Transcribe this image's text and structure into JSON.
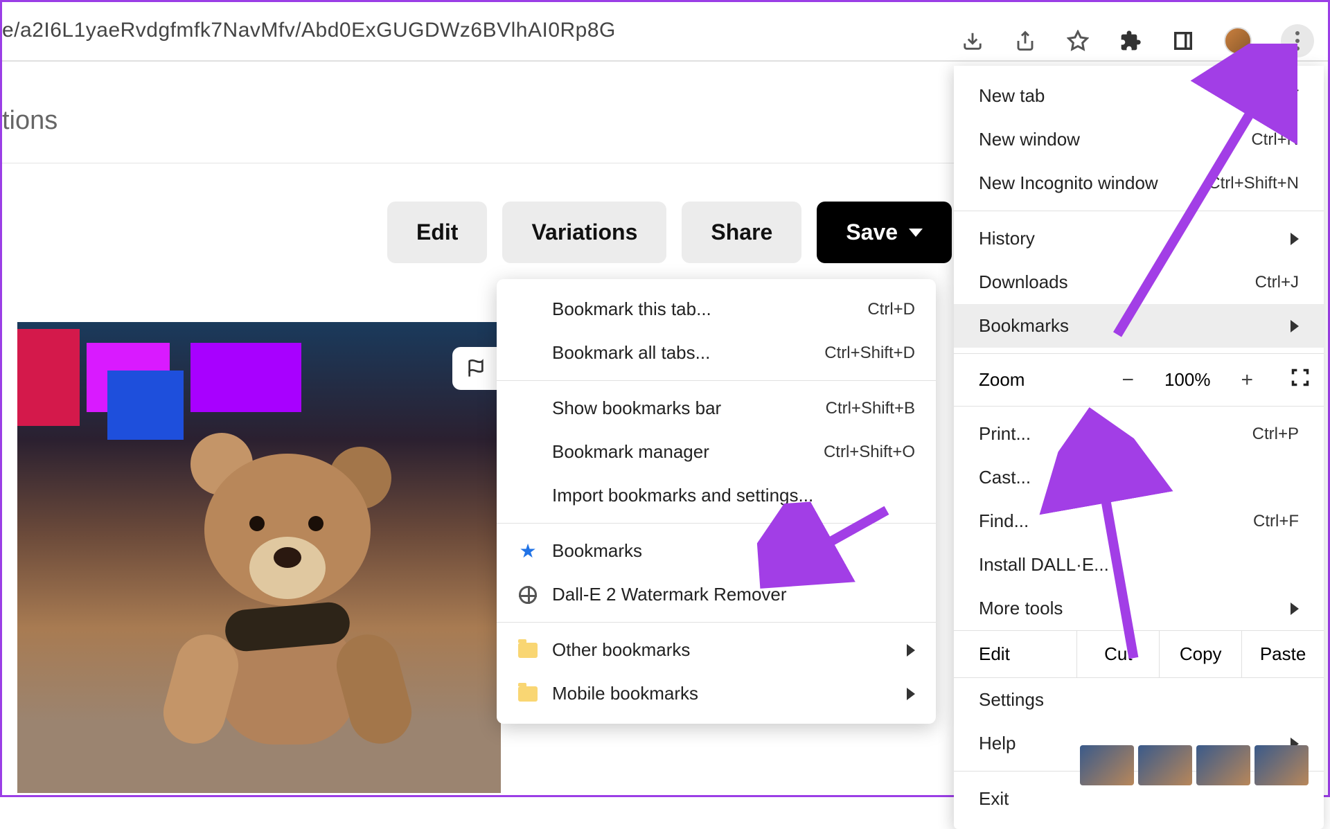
{
  "url_fragment": "e/a2I6L1yaeRvdgfmfk7NavMfv/Abd0ExGUGDWz6BVlhAI0Rp8G",
  "page_title_fragment": "tions",
  "action_buttons": {
    "edit": "Edit",
    "variations": "Variations",
    "share": "Share",
    "save": "Save"
  },
  "main_menu": {
    "new_tab": {
      "label": "New tab",
      "shortcut": "Ctrl+T"
    },
    "new_window": {
      "label": "New window",
      "shortcut": "Ctrl+N"
    },
    "new_incognito": {
      "label": "New Incognito window",
      "shortcut": "Ctrl+Shift+N"
    },
    "history": {
      "label": "History"
    },
    "downloads": {
      "label": "Downloads",
      "shortcut": "Ctrl+J"
    },
    "bookmarks": {
      "label": "Bookmarks"
    },
    "zoom": {
      "label": "Zoom",
      "value": "100%",
      "minus": "−",
      "plus": "+"
    },
    "print": {
      "label": "Print...",
      "shortcut": "Ctrl+P"
    },
    "cast": {
      "label": "Cast..."
    },
    "find": {
      "label": "Find...",
      "shortcut": "Ctrl+F"
    },
    "install": {
      "label": "Install DALL·E..."
    },
    "more_tools": {
      "label": "More tools"
    },
    "edit_row": {
      "label": "Edit",
      "cut": "Cut",
      "copy": "Copy",
      "paste": "Paste"
    },
    "settings": {
      "label": "Settings"
    },
    "help": {
      "label": "Help"
    },
    "exit": {
      "label": "Exit"
    }
  },
  "bookmarks_submenu": {
    "bookmark_tab": {
      "label": "Bookmark this tab...",
      "shortcut": "Ctrl+D"
    },
    "bookmark_all": {
      "label": "Bookmark all tabs...",
      "shortcut": "Ctrl+Shift+D"
    },
    "show_bar": {
      "label": "Show bookmarks bar",
      "shortcut": "Ctrl+Shift+B"
    },
    "manager": {
      "label": "Bookmark manager",
      "shortcut": "Ctrl+Shift+O"
    },
    "import": {
      "label": "Import bookmarks and settings..."
    },
    "bookmarks": {
      "label": "Bookmarks"
    },
    "dalle_remover": {
      "label": "Dall-E 2 Watermark Remover"
    },
    "other": {
      "label": "Other bookmarks"
    },
    "mobile": {
      "label": "Mobile bookmarks"
    }
  }
}
